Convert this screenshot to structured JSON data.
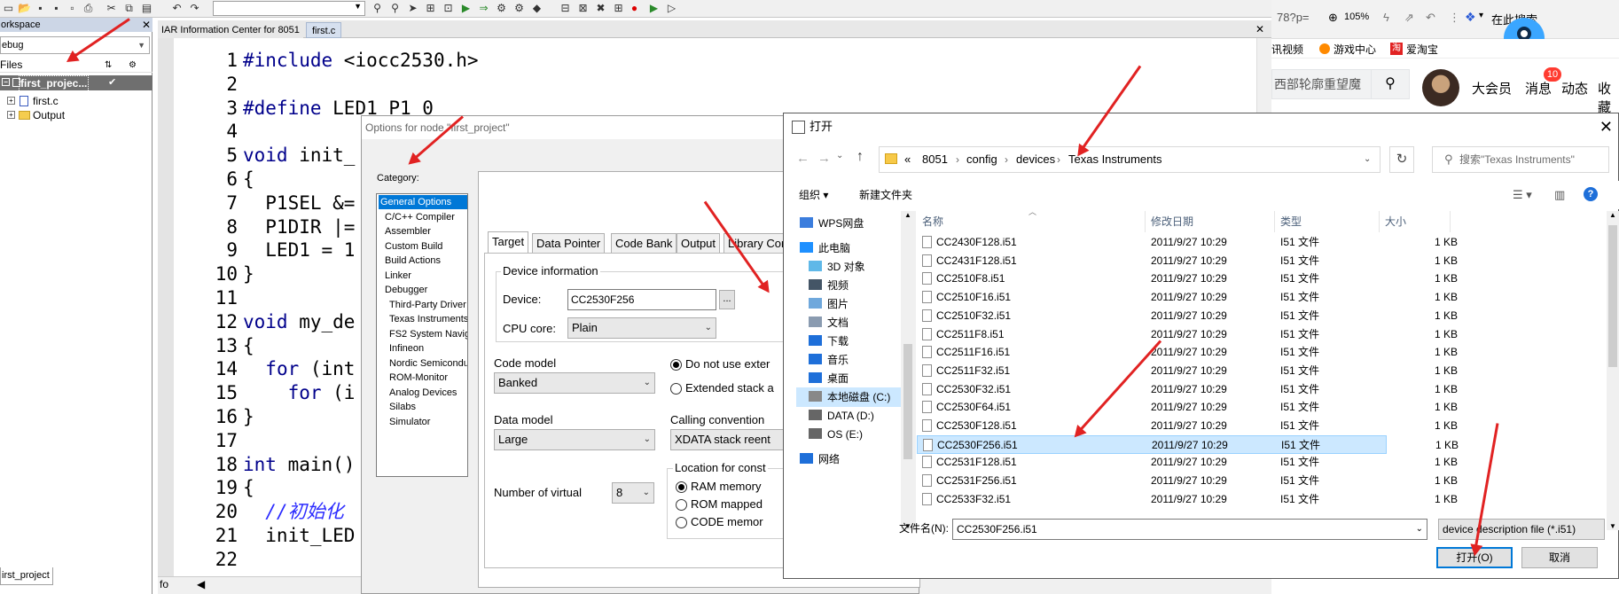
{
  "ide": {
    "workspace": {
      "title": "orkspace",
      "config": "ebug",
      "files_label": "Files",
      "project": "first_projec...",
      "items": [
        {
          "label": "first.c"
        },
        {
          "label": "Output"
        }
      ],
      "bottom_tab": "irst_project"
    },
    "editor": {
      "tabs": [
        "IAR Information Center for 8051",
        "first.c"
      ],
      "lines": [
        {
          "n": "1",
          "code": "#include <iocc2530.h>"
        },
        {
          "n": "2",
          "code": ""
        },
        {
          "n": "3",
          "code": "#define LED1 P1_0"
        },
        {
          "n": "4",
          "code": ""
        },
        {
          "n": "5",
          "code": "void init_"
        },
        {
          "n": "6",
          "code": "{"
        },
        {
          "n": "7",
          "code": "  P1SEL &="
        },
        {
          "n": "8",
          "code": "  P1DIR |="
        },
        {
          "n": "9",
          "code": "  LED1 = 1"
        },
        {
          "n": "10",
          "code": "}"
        },
        {
          "n": "11",
          "code": ""
        },
        {
          "n": "12",
          "code": "void my_de"
        },
        {
          "n": "13",
          "code": "{"
        },
        {
          "n": "14",
          "code": "  for (int"
        },
        {
          "n": "15",
          "code": "    for (i"
        },
        {
          "n": "16",
          "code": "}"
        },
        {
          "n": "17",
          "code": ""
        },
        {
          "n": "18",
          "code": "int main()"
        },
        {
          "n": "19",
          "code": "{"
        },
        {
          "n": "20",
          "code": "  //初始化"
        },
        {
          "n": "21",
          "code": "  init_LED"
        },
        {
          "n": "22",
          "code": ""
        }
      ],
      "hscroll_text": "fo"
    }
  },
  "browser": {
    "url_frag": "78?p=",
    "zoom": "105%",
    "search_here": "在此搜索",
    "bookmarks": [
      "讯视频",
      "游戏中心",
      "爱淘宝"
    ],
    "search_text": "西部轮廓重望魔",
    "nav": [
      "大会员",
      "消息",
      "动态",
      "收藏"
    ],
    "badge": "10"
  },
  "options": {
    "title": "Options for node \"first_project\"",
    "category_label": "Category:",
    "categories": [
      {
        "label": "General Options",
        "selected": true,
        "indent": false
      },
      {
        "label": "C/C++ Compiler",
        "indent": false
      },
      {
        "label": "Assembler",
        "indent": false
      },
      {
        "label": "Custom Build",
        "indent": false
      },
      {
        "label": "Build Actions",
        "indent": false
      },
      {
        "label": "Linker",
        "indent": false
      },
      {
        "label": "Debugger",
        "indent": false
      },
      {
        "label": "Third-Party Driver",
        "indent": true
      },
      {
        "label": "Texas Instruments",
        "indent": true
      },
      {
        "label": "FS2 System Navig",
        "indent": true
      },
      {
        "label": "Infineon",
        "indent": true
      },
      {
        "label": "Nordic Semiconduc",
        "indent": true
      },
      {
        "label": "ROM-Monitor",
        "indent": true
      },
      {
        "label": "Analog Devices",
        "indent": true
      },
      {
        "label": "Silabs",
        "indent": true
      },
      {
        "label": "Simulator",
        "indent": true
      }
    ],
    "tabs": [
      "Target",
      "Data Pointer",
      "Code Bank",
      "Output",
      "Library Con"
    ],
    "device_info_label": "Device information",
    "device_label": "Device:",
    "device_value": "CC2530F256",
    "browse_label": "...",
    "cpu_core_label": "CPU core:",
    "cpu_core_value": "Plain",
    "code_model_label": "Code model",
    "code_model_value": "Banked",
    "data_model_label": "Data model",
    "data_model_value": "Large",
    "radio1": "Do not use exter",
    "radio2": "Extended stack a",
    "calling_label": "Calling convention",
    "calling_value": "XDATA stack reent",
    "location_label": "Location for const",
    "loc1": "RAM memory",
    "loc2": "ROM mapped",
    "loc3": "CODE memor",
    "virtual_label": "Number of virtual",
    "virtual_value": "8"
  },
  "open_dialog": {
    "title": "打开",
    "path": [
      "«",
      "8051",
      "config",
      "devices",
      "Texas Instruments"
    ],
    "search_placeholder": "搜索\"Texas Instruments\"",
    "organize": "组织 ▾",
    "new_folder": "新建文件夹",
    "tree": [
      {
        "label": "WPS网盘",
        "icon": "cloud-icon",
        "color": "#3b7ddd"
      },
      {
        "label": "此电脑",
        "icon": "computer-icon",
        "color": "#1e90ff"
      },
      {
        "label": "3D 对象",
        "icon": "3d-icon",
        "color": "#5fb8e8"
      },
      {
        "label": "视频",
        "icon": "video-icon",
        "color": "#445566"
      },
      {
        "label": "图片",
        "icon": "picture-icon",
        "color": "#6fa8dc"
      },
      {
        "label": "文档",
        "icon": "document-icon",
        "color": "#8a9bb0"
      },
      {
        "label": "下载",
        "icon": "download-icon",
        "color": "#1e6fd9"
      },
      {
        "label": "音乐",
        "icon": "music-icon",
        "color": "#1e6fd9"
      },
      {
        "label": "桌面",
        "icon": "desktop-icon",
        "color": "#1e6fd9"
      },
      {
        "label": "本地磁盘 (C:)",
        "icon": "drive-icon",
        "color": "#888888",
        "selected": true
      },
      {
        "label": "DATA (D:)",
        "icon": "drive-icon",
        "color": "#666666"
      },
      {
        "label": "OS (E:)",
        "icon": "drive-icon",
        "color": "#666666"
      },
      {
        "label": "网络",
        "icon": "network-icon",
        "color": "#1e6fd9"
      }
    ],
    "columns": [
      "名称",
      "修改日期",
      "类型",
      "大小"
    ],
    "files": [
      {
        "name": "CC2430F128.i51",
        "date": "2011/9/27 10:29",
        "type": "I51 文件",
        "size": "1 KB"
      },
      {
        "name": "CC2431F128.i51",
        "date": "2011/9/27 10:29",
        "type": "I51 文件",
        "size": "1 KB"
      },
      {
        "name": "CC2510F8.i51",
        "date": "2011/9/27 10:29",
        "type": "I51 文件",
        "size": "1 KB"
      },
      {
        "name": "CC2510F16.i51",
        "date": "2011/9/27 10:29",
        "type": "I51 文件",
        "size": "1 KB"
      },
      {
        "name": "CC2510F32.i51",
        "date": "2011/9/27 10:29",
        "type": "I51 文件",
        "size": "1 KB"
      },
      {
        "name": "CC2511F8.i51",
        "date": "2011/9/27 10:29",
        "type": "I51 文件",
        "size": "1 KB"
      },
      {
        "name": "CC2511F16.i51",
        "date": "2011/9/27 10:29",
        "type": "I51 文件",
        "size": "1 KB"
      },
      {
        "name": "CC2511F32.i51",
        "date": "2011/9/27 10:29",
        "type": "I51 文件",
        "size": "1 KB"
      },
      {
        "name": "CC2530F32.i51",
        "date": "2011/9/27 10:29",
        "type": "I51 文件",
        "size": "1 KB"
      },
      {
        "name": "CC2530F64.i51",
        "date": "2011/9/27 10:29",
        "type": "I51 文件",
        "size": "1 KB"
      },
      {
        "name": "CC2530F128.i51",
        "date": "2011/9/27 10:29",
        "type": "I51 文件",
        "size": "1 KB"
      },
      {
        "name": "CC2530F256.i51",
        "date": "2011/9/27 10:29",
        "type": "I51 文件",
        "size": "1 KB",
        "selected": true
      },
      {
        "name": "CC2531F128.i51",
        "date": "2011/9/27 10:29",
        "type": "I51 文件",
        "size": "1 KB"
      },
      {
        "name": "CC2531F256.i51",
        "date": "2011/9/27 10:29",
        "type": "I51 文件",
        "size": "1 KB"
      },
      {
        "name": "CC2533F32.i51",
        "date": "2011/9/27 10:29",
        "type": "I51 文件",
        "size": "1 KB"
      }
    ],
    "filename_label": "文件名(N):",
    "filename_value": "CC2530F256.i51",
    "filetype_value": "device description file (*.i51)",
    "open_label": "打开(O)",
    "cancel_label": "取消"
  },
  "colors": {
    "annotation_red": "#e12222",
    "selection_blue": "#cce8ff",
    "accent": "#0078d7"
  }
}
